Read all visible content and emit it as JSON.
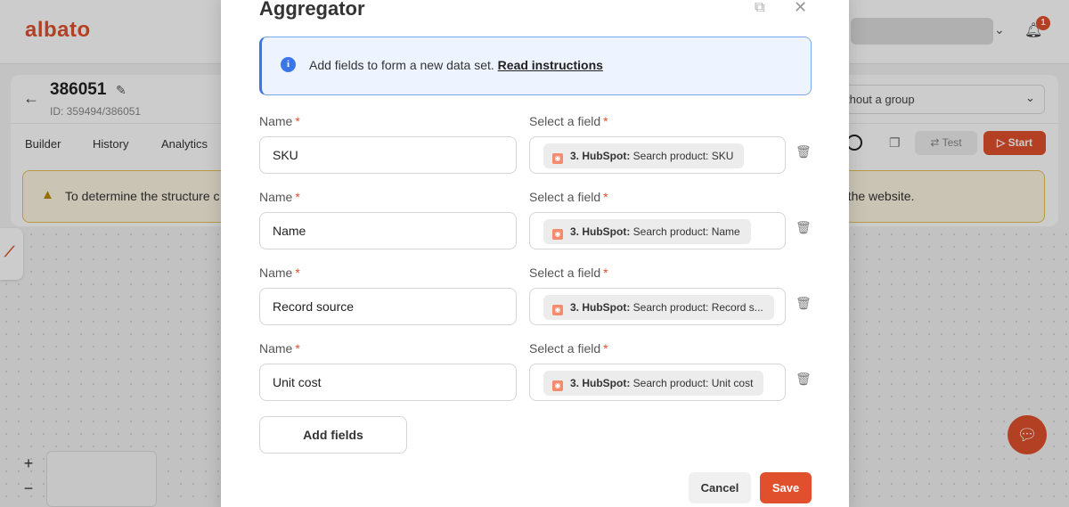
{
  "app": {
    "logo": "albato",
    "notification_count": "1",
    "scenario_title": "386051",
    "scenario_id": "ID: 359494/386051",
    "tabs": [
      {
        "label": "Builder"
      },
      {
        "label": "History"
      },
      {
        "label": "Analytics"
      }
    ],
    "group_select_visible": "thout a group",
    "test_label": "Test",
    "start_label": "Start",
    "warning_left": "To determine the structure c",
    "warning_right": "o the website.",
    "zoom_in": "+",
    "zoom_out": "−"
  },
  "modal": {
    "title": "Aggregator",
    "info_text": "Add fields to form a new data set.",
    "info_link": "Read instructions",
    "name_label": "Name",
    "field_label": "Select a field",
    "required_mark": "*",
    "rows": [
      {
        "name": "SKU",
        "chip_source": "3. HubSpot:",
        "chip_text": "Search product: SKU"
      },
      {
        "name": "Name",
        "chip_source": "3. HubSpot:",
        "chip_text": "Search product: Name"
      },
      {
        "name": "Record source",
        "chip_source": "3. HubSpot:",
        "chip_text": "Search product: Record s..."
      },
      {
        "name": "Unit cost",
        "chip_source": "3. HubSpot:",
        "chip_text": "Search product: Unit cost"
      }
    ],
    "add_fields_label": "Add fields",
    "cancel_label": "Cancel",
    "save_label": "Save"
  },
  "colors": {
    "brand": "#e0502c",
    "info_accent": "#3b76e8",
    "warning_border": "#e8c155"
  },
  "icons": [
    "back-arrow-icon",
    "edit-icon",
    "bell-icon",
    "info-icon",
    "warning-icon",
    "pin-icon",
    "close-icon",
    "hubspot-icon",
    "trash-icon",
    "chat-icon",
    "copy-icon"
  ]
}
